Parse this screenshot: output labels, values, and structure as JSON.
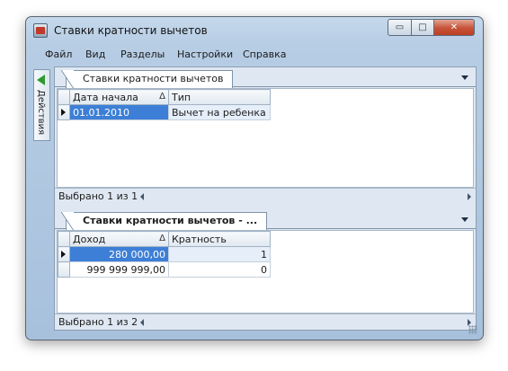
{
  "window": {
    "title": "Ставки кратности вычетов"
  },
  "title_controls": {
    "minimize": "▭",
    "maximize": "□",
    "close": "✕"
  },
  "menu": [
    "Файл",
    "Вид",
    "Разделы",
    "Настройки",
    "Справка"
  ],
  "side_panel": {
    "label": "Действия",
    "icon": "green-arrow-icon"
  },
  "top_section": {
    "tab": "Ставки кратности вычетов",
    "columns": [
      "Дата начала",
      "Тип"
    ],
    "sort_indicator": "Δ",
    "rows": [
      [
        "01.01.2010",
        "Вычет на ребенка"
      ]
    ],
    "status": "Выбрано 1 из 1"
  },
  "bottom_section": {
    "tab": "Ставки кратности вычетов - ...",
    "columns": [
      "Доход",
      "Кратность"
    ],
    "sort_indicator": "Δ",
    "rows": [
      [
        "280 000,00",
        "1"
      ],
      [
        "999 999 999,00",
        "0"
      ]
    ],
    "status": "Выбрано 1 из 2"
  },
  "colors": {
    "selection": "#3d7fd6",
    "accent": "#2f9a2f"
  }
}
